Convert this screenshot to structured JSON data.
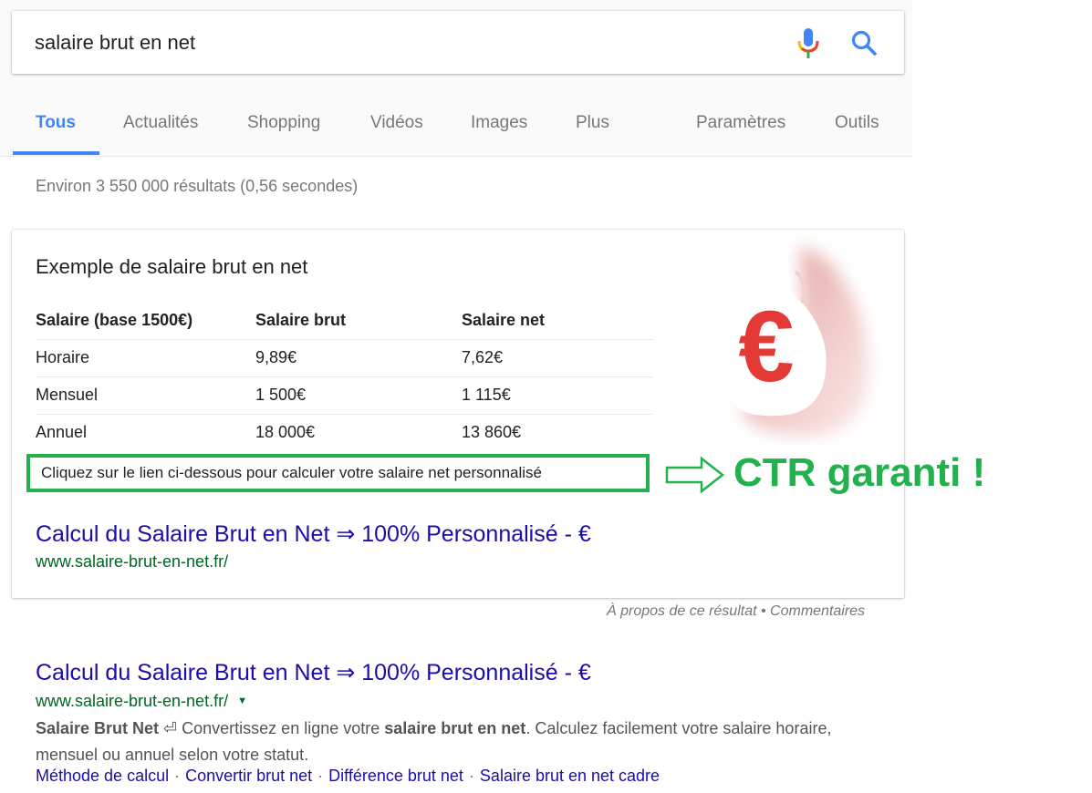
{
  "search": {
    "query": "salaire brut en net",
    "mic_icon": "microphone-icon",
    "search_icon": "magnifier-icon"
  },
  "tabs": [
    {
      "label": "Tous",
      "active": true
    },
    {
      "label": "Actualités",
      "active": false
    },
    {
      "label": "Shopping",
      "active": false
    },
    {
      "label": "Vidéos",
      "active": false
    },
    {
      "label": "Images",
      "active": false
    },
    {
      "label": "Plus",
      "active": false
    },
    {
      "label": "Paramètres",
      "active": false
    },
    {
      "label": "Outils",
      "active": false
    }
  ],
  "result_stats": "Environ 3 550 000 résultats (0,56 secondes)",
  "featured_snippet": {
    "title": "Exemple de salaire brut en net",
    "table": {
      "headers": [
        "Salaire (base 1500€)",
        "Salaire brut",
        "Salaire net"
      ],
      "rows": [
        [
          "Horaire",
          "9,89€",
          "7,62€"
        ],
        [
          "Mensuel",
          "1 500€",
          "1 115€"
        ],
        [
          "Annuel",
          "18 000€",
          "13 860€"
        ]
      ]
    },
    "cta_text": "Cliquez sur le lien ci-dessous pour calculer votre salaire net personnalisé",
    "image_icon": "euro-money-bag-icon",
    "link_title": "Calcul du Salaire Brut en Net ⇒ 100% Personnalisé - €",
    "link_url": "www.salaire-brut-en-net.fr/"
  },
  "annotation": {
    "arrow_icon": "right-arrow-outline-icon",
    "text": "CTR garanti !",
    "color": "#22b14c"
  },
  "about": {
    "about_label": "À propos de ce résultat",
    "separator": " • ",
    "feedback_label": "Commentaires"
  },
  "result2": {
    "title": "Calcul du Salaire Brut en Net ⇒ 100% Personnalisé - €",
    "url": "www.salaire-brut-en-net.fr/",
    "url_dropdown": "▼",
    "desc_parts": {
      "bold1": "Salaire Brut Net",
      "symbol": " ⏎ ",
      "text1": "Convertissez en ligne votre ",
      "bold2": "salaire brut en net",
      "text2": ". Calculez facilement votre salaire horaire, mensuel ou annuel selon votre statut."
    },
    "sitelinks": [
      "Méthode de calcul",
      "Convertir brut net",
      "Différence brut net",
      "Salaire brut en net cadre"
    ],
    "sitelink_separator": "·"
  },
  "colors": {
    "accent_blue": "#4285f4",
    "link_blue": "#1a0dab",
    "url_green": "#006621",
    "annotation_green": "#22b14c",
    "euro_red": "#e53935"
  }
}
